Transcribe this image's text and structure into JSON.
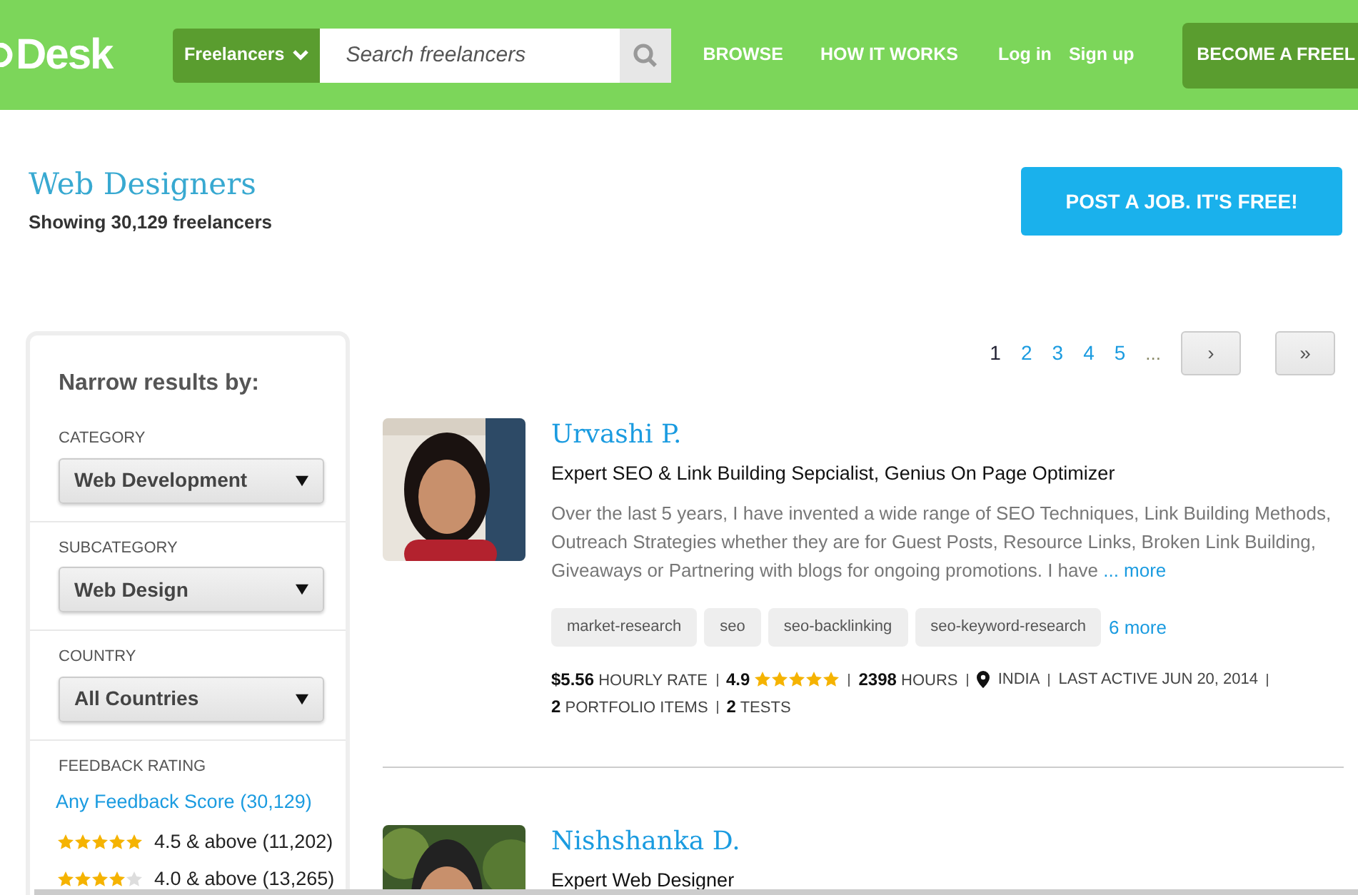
{
  "header": {
    "logo": "Desk",
    "category_button": "Freelancers",
    "search": {
      "placeholder": "Search freelancers"
    },
    "nav": [
      "BROWSE",
      "HOW IT WORKS",
      "Log in",
      "Sign up"
    ],
    "cta": "BECOME A FREEL"
  },
  "page": {
    "title": "Web Designers",
    "subtitle": "Showing 30,129 freelancers",
    "post_job": "POST A JOB. IT'S FREE!"
  },
  "sidebar": {
    "heading": "Narrow results by:",
    "filters": [
      {
        "label": "CATEGORY",
        "value": "Web Development"
      },
      {
        "label": "SUBCATEGORY",
        "value": "Web Design"
      },
      {
        "label": "COUNTRY",
        "value": "All Countries"
      }
    ],
    "feedback": {
      "label": "FEEDBACK RATING",
      "options": [
        {
          "kind": "link",
          "text": "Any Feedback Score (30,129)"
        },
        {
          "kind": "stars",
          "stars": 5,
          "text": "4.5 & above (11,202)"
        },
        {
          "kind": "stars",
          "stars": 4,
          "text": "4.0 & above (13,265)"
        }
      ]
    }
  },
  "pagination": {
    "pages": [
      {
        "label": "1",
        "selected": true
      },
      {
        "label": "2",
        "selected": false
      },
      {
        "label": "3",
        "selected": false
      },
      {
        "label": "4",
        "selected": false
      },
      {
        "label": "5",
        "selected": false
      }
    ],
    "ellipsis": "...",
    "next": "›",
    "last": "»"
  },
  "freelancers": [
    {
      "name": "Urvashi P.",
      "title": "Expert SEO & Link Building Sepcialist, Genius On Page Optimizer",
      "description": "Over the last 5 years, I have invented a wide range of SEO Techniques, Link Building Methods, Outreach Strategies whether they are for Guest Posts, Resource Links, Broken Link Building, Giveaways or Partnering with blogs for ongoing promotions. I have",
      "more": "... more",
      "tags": [
        "market-research",
        "seo",
        "seo-backlinking",
        "seo-keyword-research"
      ],
      "tags_more": "6 more",
      "stats": {
        "rate": "$5.56",
        "rate_label": "HOURLY RATE",
        "score": "4.9",
        "stars": 5,
        "hours": "2398",
        "hours_label": "HOURS",
        "country": "INDIA",
        "last_active": "LAST ACTIVE JUN 20, 2014",
        "portfolio": "2",
        "portfolio_label": "PORTFOLIO ITEMS",
        "tests": "2",
        "tests_label": "TESTS"
      }
    },
    {
      "name": "Nishshanka D.",
      "title": "Expert Web Designer"
    }
  ]
}
